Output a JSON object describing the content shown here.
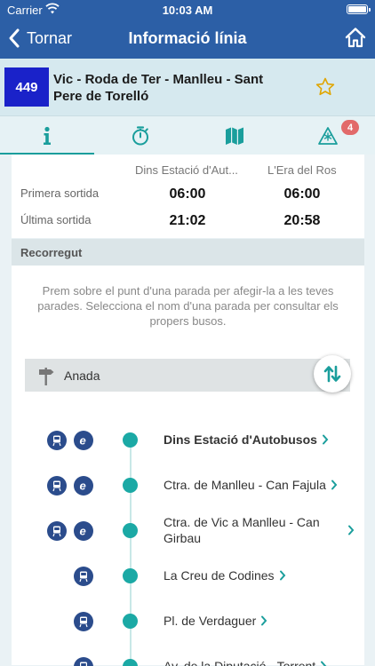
{
  "status_bar": {
    "carrier": "Carrier",
    "time": "10:03 AM"
  },
  "nav": {
    "back_label": "Tornar",
    "title": "Informació línia"
  },
  "line": {
    "number": "449",
    "name": "Vic - Roda de Ter - Manlleu - Sant Pere de Torelló",
    "badge_color": "#1a22c9"
  },
  "tabs": [
    {
      "name": "info",
      "icon": "info-icon",
      "active": true
    },
    {
      "name": "timetable",
      "icon": "stopwatch-icon",
      "active": false
    },
    {
      "name": "map",
      "icon": "map-icon",
      "active": false
    },
    {
      "name": "alerts",
      "icon": "alert-icon",
      "badge": "4",
      "active": false
    }
  ],
  "schedule": {
    "headers": [
      "Dins Estació d'Aut...",
      "L'Era del Ros"
    ],
    "rows": [
      {
        "label": "Primera sortida",
        "values": [
          "06:00",
          "06:00"
        ]
      },
      {
        "label": "Última sortida",
        "values": [
          "21:02",
          "20:58"
        ]
      }
    ]
  },
  "route": {
    "section_title": "Recorregut",
    "instructions": "Prem sobre el punt d'una parada per afegir-la a les teves parades. Selecciona el nom d'una parada per consultar els propers busos.",
    "direction_label": "Anada",
    "accent_color": "#1ba9a5",
    "stops": [
      {
        "name": "Dins Estació d'Autobusos",
        "bold": true,
        "icons": [
          "bus-stop-icon",
          "e-icon"
        ]
      },
      {
        "name": "Ctra. de Manlleu - Can Fajula",
        "bold": false,
        "icons": [
          "bus-stop-icon",
          "e-icon"
        ]
      },
      {
        "name": "Ctra. de Vic a Manlleu - Can Girbau",
        "bold": false,
        "icons": [
          "bus-stop-icon",
          "e-icon"
        ]
      },
      {
        "name": "La Creu de Codines",
        "bold": false,
        "icons": [
          "bus-stop-icon"
        ]
      },
      {
        "name": "Pl. de Verdaguer",
        "bold": false,
        "icons": [
          "bus-stop-icon"
        ]
      },
      {
        "name": "Av. de la Diputació - Torrent",
        "bold": false,
        "icons": [
          "bus-stop-icon"
        ]
      }
    ]
  }
}
